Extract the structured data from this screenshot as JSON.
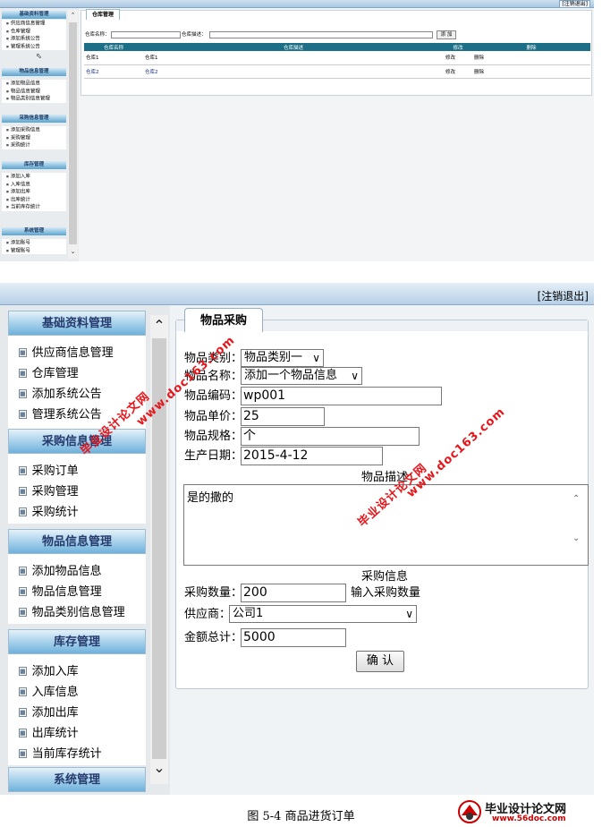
{
  "top": {
    "logout": "[注销退出]",
    "tab": "仓库管理",
    "search": {
      "name_label": "仓库名称：",
      "desc_label": "仓库描述：",
      "add_button": "添 加"
    },
    "columns": [
      "仓库名称",
      "仓库描述",
      "修改",
      "删除"
    ],
    "rows": [
      [
        "仓库1",
        "仓库1",
        "修改",
        "删除"
      ],
      [
        "仓库2",
        "仓库2",
        "修改",
        "删除"
      ]
    ],
    "sidebar": [
      {
        "title": "基础资料管理",
        "items": [
          "供应商信息管理",
          "仓库管理",
          "添加系统公告",
          "管理系统公告"
        ]
      },
      {
        "title": "物品信息管理",
        "items": [
          "添加物品信息",
          "物品信息管理",
          "物品类别信息管理"
        ]
      },
      {
        "title": "采购信息管理",
        "items": [
          "添加采购信息",
          "采购管理",
          "采购统计"
        ]
      },
      {
        "title": "库存管理",
        "items": [
          "添加入库",
          "入库信息",
          "添加出库",
          "出库统计",
          "当前库存统计"
        ]
      },
      {
        "title": "系统管理",
        "items": [
          "添加账号",
          "管理账号"
        ]
      }
    ]
  },
  "bottom": {
    "logout": "[注销退出]",
    "tab": "物品采购",
    "sidebar": [
      {
        "title": "基础资料管理",
        "items": [
          "供应商信息管理",
          "仓库管理",
          "添加系统公告",
          "管理系统公告"
        ]
      },
      {
        "title": "采购信息管理",
        "items": [
          "采购订单",
          "采购管理",
          "采购统计"
        ]
      },
      {
        "title": "物品信息管理",
        "items": [
          "添加物品信息",
          "物品信息管理",
          "物品类别信息管理"
        ]
      },
      {
        "title": "库存管理",
        "items": [
          "添加入库",
          "入库信息",
          "添加出库",
          "出库统计",
          "当前库存统计"
        ]
      },
      {
        "title": "系统管理",
        "items": []
      }
    ],
    "form": {
      "category_label": "物品类别：",
      "category_value": "物品类别一",
      "name_label": "物品名称：",
      "name_value": "添加一个物品信息",
      "code_label": "物品编码：",
      "code_value": "wp001",
      "price_label": "物品单价：",
      "price_value": "25",
      "spec_label": "物品规格：",
      "spec_value": "个",
      "date_label": "生产日期：",
      "date_value": "2015-4-12",
      "desc_heading": "物品描述",
      "desc_value": "是的撒的",
      "purchase_heading": "采购信息",
      "qty_label": "采购数量：",
      "qty_value": "200",
      "qty_hint": "输入采购数量",
      "supplier_label": "供应商：",
      "supplier_value": "公司1",
      "total_label": "金额总计：",
      "total_value": "5000",
      "confirm_button": "确 认"
    }
  },
  "watermarks": [
    "毕业设计论文网",
    "www.doc163.com"
  ],
  "caption": "图 5-4 商品进货订单",
  "logo": {
    "title": "毕业设计论文网",
    "url": "www.56doc.com"
  }
}
